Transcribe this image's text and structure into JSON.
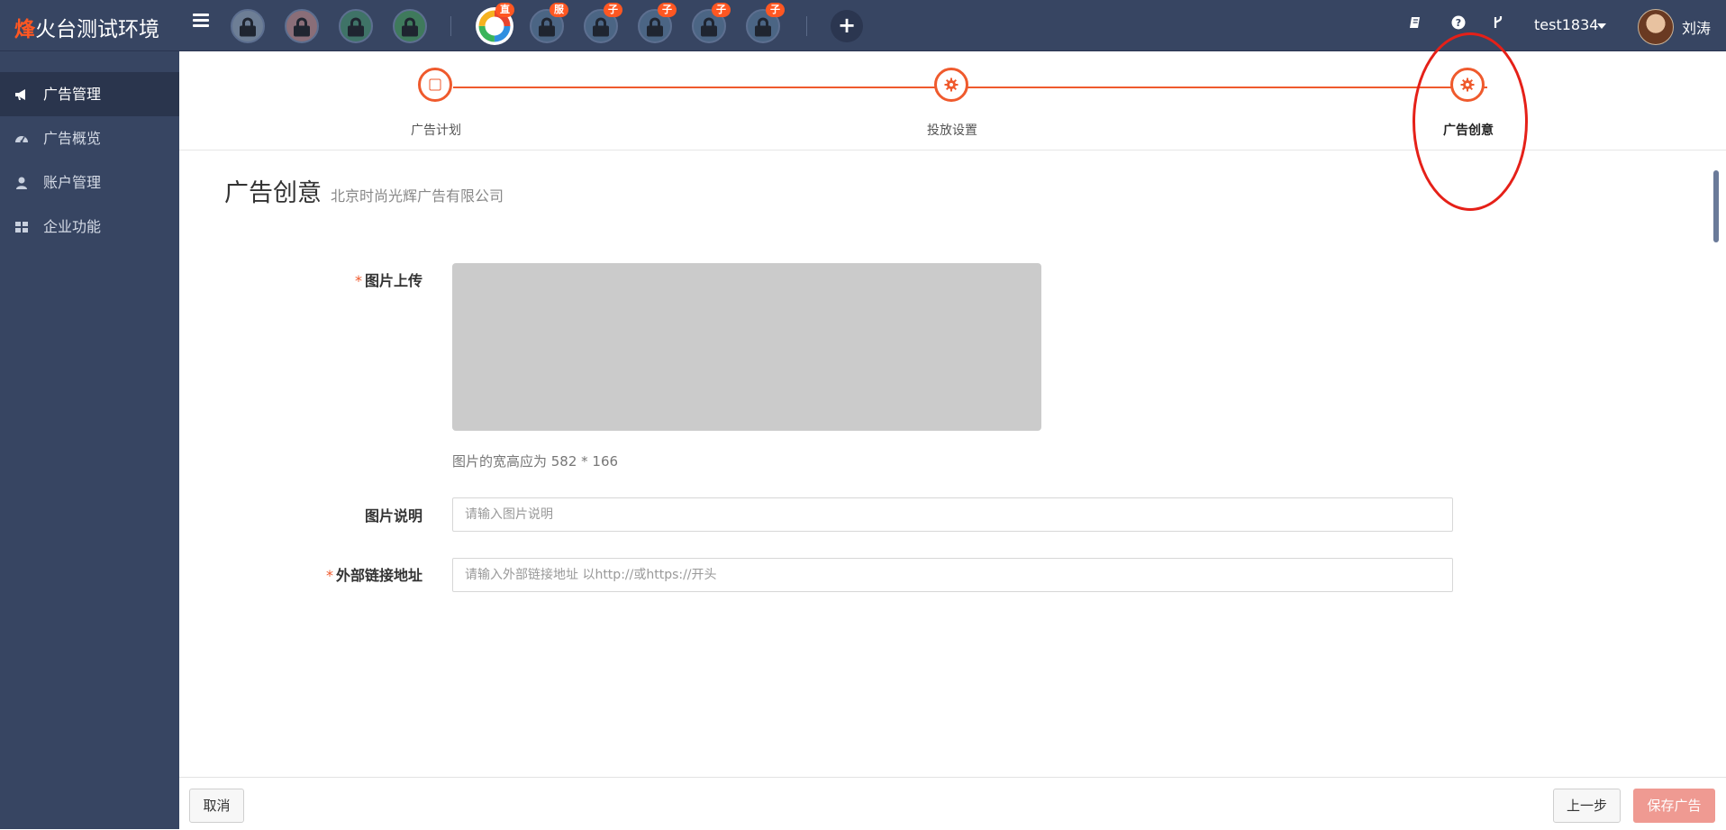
{
  "app": {
    "brand_accent": "烽",
    "brand_rest": "火台测试环境"
  },
  "topbar": {
    "accounts": [
      {
        "name": "account-1",
        "badge": ""
      },
      {
        "name": "account-2",
        "badge": ""
      },
      {
        "name": "account-3",
        "badge": ""
      },
      {
        "name": "account-4",
        "badge": ""
      },
      {
        "name": "account-active",
        "badge": "直"
      },
      {
        "name": "account-6",
        "badge": "服"
      },
      {
        "name": "account-7",
        "badge": "子"
      },
      {
        "name": "account-8",
        "badge": "子"
      },
      {
        "name": "account-9",
        "badge": "子"
      },
      {
        "name": "account-10",
        "badge": "子"
      }
    ],
    "icons": [
      "book-icon",
      "help-icon",
      "branch-icon"
    ],
    "username": "test1834",
    "real_name": "刘涛"
  },
  "sidebar": {
    "items": [
      {
        "label": "广告管理",
        "icon": "megaphone-icon",
        "active": true
      },
      {
        "label": "广告概览",
        "icon": "dashboard-icon",
        "active": false
      },
      {
        "label": "账户管理",
        "icon": "user-icon",
        "active": false
      },
      {
        "label": "企业功能",
        "icon": "grid-icon",
        "active": false
      }
    ]
  },
  "steps": [
    {
      "label": "广告计划",
      "icon": "square-icon"
    },
    {
      "label": "投放设置",
      "icon": "gear-icon"
    },
    {
      "label": "广告创意",
      "icon": "gear-icon",
      "active": true
    }
  ],
  "page": {
    "title": "广告创意",
    "subtitle": "北京时尚光辉广告有限公司"
  },
  "form": {
    "image_upload_label": "图片上传",
    "image_hint": "图片的宽高应为 582 * 166",
    "image_desc_label": "图片说明",
    "image_desc_placeholder": "请输入图片说明",
    "image_desc_value": "",
    "link_label": "外部链接地址",
    "link_placeholder": "请输入外部链接地址 以http://或https://开头",
    "link_value": "",
    "required_mark": "*"
  },
  "footer": {
    "cancel_label": "取消",
    "prev_label": "上一步",
    "save_label": "保存广告"
  },
  "colors": {
    "primary": "#ef5a2d",
    "topbar": "#374562",
    "highlight": "#e52018"
  }
}
